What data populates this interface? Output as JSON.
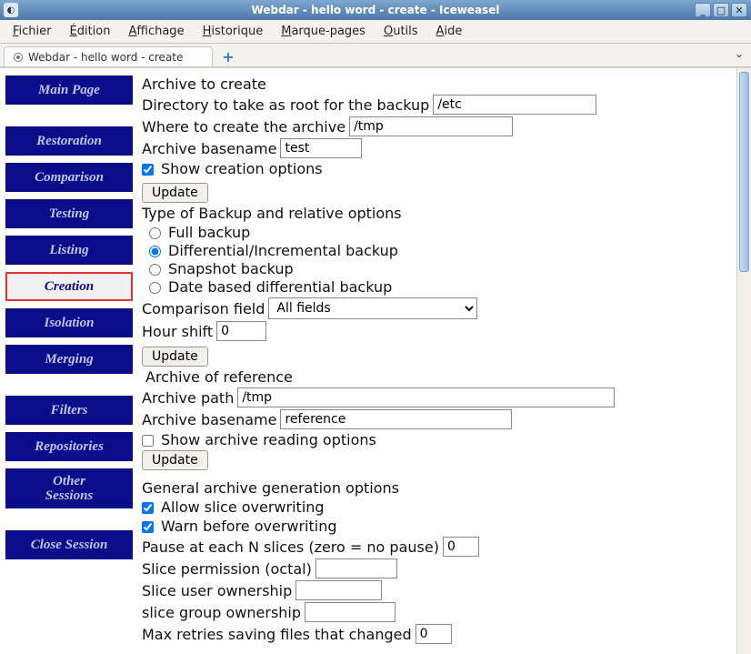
{
  "window": {
    "title": "Webdar - hello word - create - Iceweasel"
  },
  "menubar": {
    "items": [
      {
        "text": "Fichier",
        "ukey": "F"
      },
      {
        "text": "Édition",
        "ukey": "É"
      },
      {
        "text": "Affichage",
        "ukey": "A"
      },
      {
        "text": "Historique",
        "ukey": "H"
      },
      {
        "text": "Marque-pages",
        "ukey": "M"
      },
      {
        "text": "Outils",
        "ukey": "O"
      },
      {
        "text": "Aide",
        "ukey": "A"
      }
    ]
  },
  "tab": {
    "label": "Webdar - hello word - create"
  },
  "sidebar": {
    "items": [
      {
        "label": "Main Page",
        "name": "sidebar-item-main-page"
      },
      {
        "label": "Restoration",
        "name": "sidebar-item-restoration",
        "gap_before": true
      },
      {
        "label": "Comparison",
        "name": "sidebar-item-comparison"
      },
      {
        "label": "Testing",
        "name": "sidebar-item-testing"
      },
      {
        "label": "Listing",
        "name": "sidebar-item-listing"
      },
      {
        "label": "Creation",
        "name": "sidebar-item-creation",
        "active": true
      },
      {
        "label": "Isolation",
        "name": "sidebar-item-isolation"
      },
      {
        "label": "Merging",
        "name": "sidebar-item-merging"
      },
      {
        "label": "Filters",
        "name": "sidebar-item-filters",
        "gap_before": true
      },
      {
        "label": "Repositories",
        "name": "sidebar-item-repositories"
      },
      {
        "label": "Other\nSessions",
        "name": "sidebar-item-other-sessions",
        "tall": true
      },
      {
        "label": "Close Session",
        "name": "sidebar-item-close-session",
        "gap_before": true
      }
    ]
  },
  "form": {
    "heading_create": "Archive to create",
    "dir_root_label": "Directory to take as root for the backup",
    "dir_root_value": "/etc",
    "where_label": "Where to create the archive",
    "where_value": "/tmp",
    "basename_label": "Archive basename",
    "basename_value": "test",
    "show_create_opts_label": "Show creation options",
    "show_create_opts_checked": true,
    "update_label": "Update",
    "heading_backup_type": "Type of Backup and relative options",
    "backup_types": {
      "full": "Full backup",
      "diff": "Differential/Incremental backup",
      "snap": "Snapshot backup",
      "date": "Date based differential backup",
      "selected": "diff"
    },
    "comparison_field_label": "Comparison field",
    "comparison_field_value": "All fields",
    "hour_shift_label": "Hour shift",
    "hour_shift_value": "0",
    "heading_ref": "Archive of reference",
    "ref_path_label": "Archive path",
    "ref_path_value": "/tmp",
    "ref_basename_label": "Archive basename",
    "ref_basename_value": "reference",
    "show_read_opts_label": "Show archive reading options",
    "show_read_opts_checked": false,
    "heading_general": "General archive generation options",
    "allow_overwrite_label": "Allow slice overwriting",
    "allow_overwrite_checked": true,
    "warn_overwrite_label": "Warn before overwriting",
    "warn_overwrite_checked": true,
    "pause_label": "Pause at each N slices (zero = no pause)",
    "pause_value": "0",
    "slice_perm_label": "Slice permission (octal)",
    "slice_perm_value": "",
    "slice_user_label": "Slice user ownership",
    "slice_user_value": "",
    "slice_group_label": "slice group ownership",
    "slice_group_value": "",
    "max_retries_label": "Max retries saving files that changed",
    "max_retries_value": "0"
  }
}
